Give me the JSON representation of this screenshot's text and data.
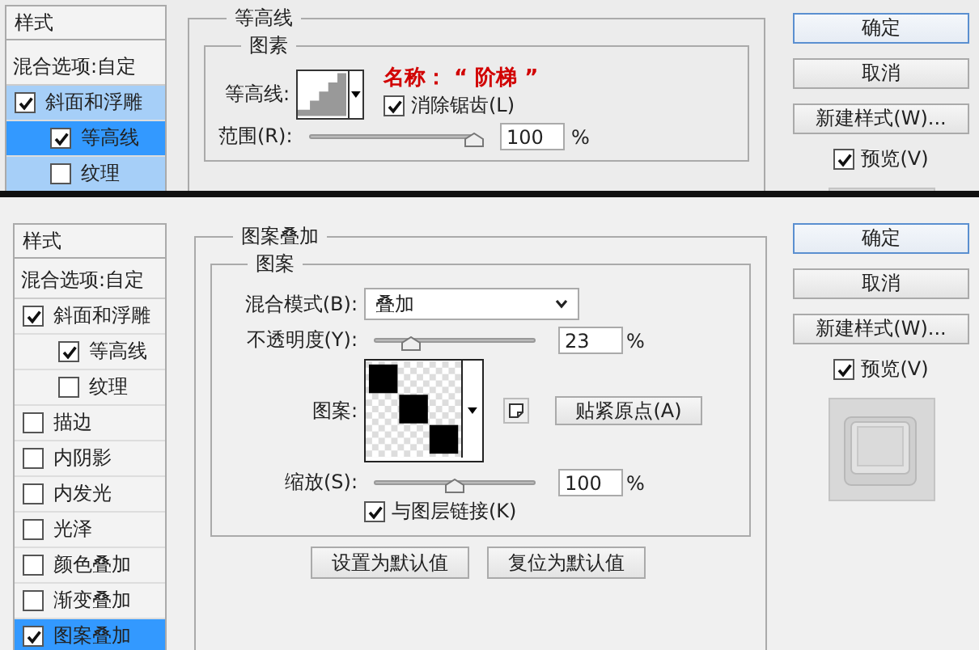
{
  "panels": [
    {
      "kind": "contour",
      "styles_header": "样式",
      "blend_options": "混合选项:自定",
      "effects": [
        {
          "label": "斜面和浮雕",
          "checked": true,
          "selected": false,
          "highlighted": true,
          "children": [
            {
              "label": "等高线",
              "checked": true,
              "selected": true,
              "highlighted": true
            },
            {
              "label": "纹理",
              "checked": false,
              "selected": false,
              "highlighted": true
            }
          ]
        }
      ],
      "section_title": "等高线",
      "group_title": "图素",
      "contour_label": "等高线:",
      "annotation": "名称： “ 阶梯 ”",
      "anti_alias": {
        "label": "消除锯齿(L)",
        "checked": true
      },
      "range": {
        "label": "范围(R):",
        "level": 1,
        "value": "100",
        "unit": "%"
      },
      "buttons": [
        {
          "label": "确定",
          "default": true
        },
        {
          "label": "取消",
          "default": false
        },
        {
          "label": "新建样式(W)...",
          "default": false
        }
      ],
      "preview": {
        "label": "预览(V)",
        "checked": true
      }
    },
    {
      "kind": "pattern",
      "styles_header": "样式",
      "blend_options": "混合选项:自定",
      "effects": [
        {
          "label": "斜面和浮雕",
          "checked": true,
          "selected": false,
          "highlighted": false,
          "children": [
            {
              "label": "等高线",
              "checked": true,
              "selected": false,
              "highlighted": false
            },
            {
              "label": "纹理",
              "checked": false,
              "selected": false,
              "highlighted": false
            }
          ]
        },
        {
          "label": "描边",
          "checked": false,
          "selected": false,
          "highlighted": false
        },
        {
          "label": "内阴影",
          "checked": false,
          "selected": false,
          "highlighted": false
        },
        {
          "label": "内发光",
          "checked": false,
          "selected": false,
          "highlighted": false
        },
        {
          "label": "光泽",
          "checked": false,
          "selected": false,
          "highlighted": false
        },
        {
          "label": "颜色叠加",
          "checked": false,
          "selected": false,
          "highlighted": false
        },
        {
          "label": "渐变叠加",
          "checked": false,
          "selected": false,
          "highlighted": false
        },
        {
          "label": "图案叠加",
          "checked": true,
          "selected": true,
          "highlighted": false
        }
      ],
      "section_title": "图案叠加",
      "group_title": "图案",
      "blend_mode": {
        "label": "混合模式(B):",
        "value": "叠加"
      },
      "opacity": {
        "label": "不透明度(Y):",
        "level": 0.23,
        "value": "23",
        "unit": "%"
      },
      "pattern": {
        "label": "图案:",
        "snap_button": "贴紧原点(A)"
      },
      "scale": {
        "label": "缩放(S):",
        "level": 0.5,
        "value": "100",
        "unit": "%"
      },
      "link": {
        "label": "与图层链接(K)",
        "checked": true
      },
      "default_buttons": [
        "设置为默认值",
        "复位为默认值"
      ],
      "buttons": [
        {
          "label": "确定",
          "default": true
        },
        {
          "label": "取消",
          "default": false
        },
        {
          "label": "新建样式(W)...",
          "default": false
        }
      ],
      "preview": {
        "label": "预览(V)",
        "checked": true
      }
    }
  ]
}
